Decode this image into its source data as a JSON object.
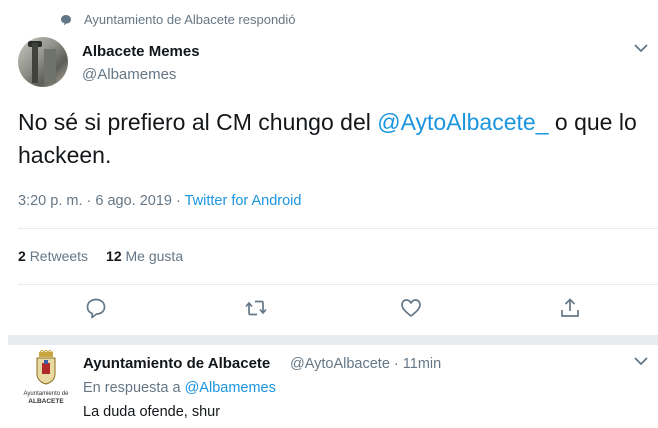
{
  "context": {
    "text": "Ayuntamiento de Albacete respondió",
    "icon": "speech-bubble-icon"
  },
  "tweet": {
    "author_name": "Albacete Memes",
    "author_handle": "@Albamemes",
    "text_before": "No sé si prefiero al CM chungo del ",
    "mention": "@AytoAlbacete_",
    "text_after": " o que lo hackeen.",
    "timestamp": "3:20 p. m. · 6 ago. 2019 · ",
    "source": "Twitter for Android",
    "retweets_count": "2",
    "retweets_label": "Retweets",
    "likes_count": "12",
    "likes_label": "Me gusta"
  },
  "reply": {
    "author_name": "Ayuntamiento de Albacete",
    "author_handle_time": "@AytoAlbacete · 11min",
    "in_reply_prefix": "En respuesta a ",
    "in_reply_handle": "@Albamemes",
    "text": "La duda ofende, shur",
    "crest_line1": "Ayuntamiento de",
    "crest_line2": "ALBACETE"
  },
  "colors": {
    "link": "#1b95e0",
    "secondary_text": "#657786",
    "divider": "#e6ecf0"
  }
}
